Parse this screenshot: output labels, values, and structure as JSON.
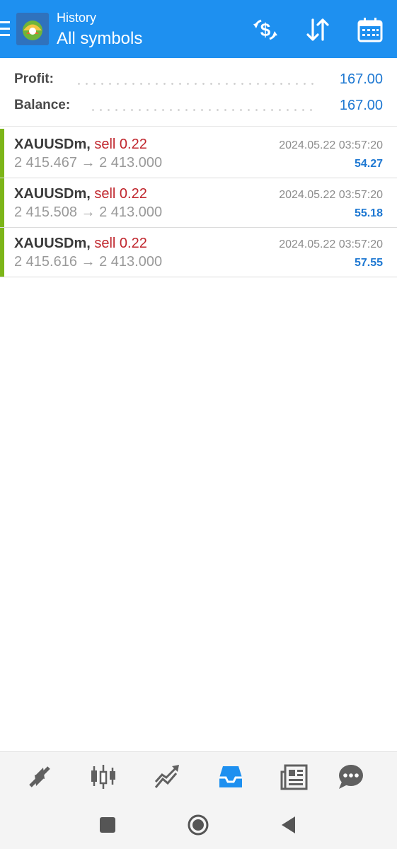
{
  "header": {
    "title": "History",
    "subtitle": "All symbols",
    "actions": [
      "deposit-icon",
      "sort-icon",
      "calendar-icon"
    ],
    "color": "#1e90f0"
  },
  "summary": {
    "profit_label": "Profit:",
    "profit_value": "167.00",
    "balance_label": "Balance:",
    "balance_value": "167.00"
  },
  "deals": [
    {
      "symbol": "XAUUSDm,",
      "side": "sell 0.22",
      "prices": "2 415.467 → 2 413.000",
      "time": "2024.05.22 03:57:20",
      "profit": "54.27"
    },
    {
      "symbol": "XAUUSDm,",
      "side": "sell 0.22",
      "prices": "2 415.508 → 2 413.000",
      "time": "2024.05.22 03:57:20",
      "profit": "55.18"
    },
    {
      "symbol": "XAUUSDm,",
      "side": "sell 0.22",
      "prices": "2 415.616 → 2 413.000",
      "time": "2024.05.22 03:57:20",
      "profit": "57.55"
    }
  ],
  "bottom_nav": {
    "items": [
      "quotes-icon",
      "chart-icon",
      "trade-icon",
      "history-icon",
      "news-icon",
      "messages-icon"
    ],
    "active": "history-icon",
    "active_color": "#1e90f0"
  },
  "system_nav": [
    "recents-icon",
    "home-icon",
    "back-icon"
  ]
}
